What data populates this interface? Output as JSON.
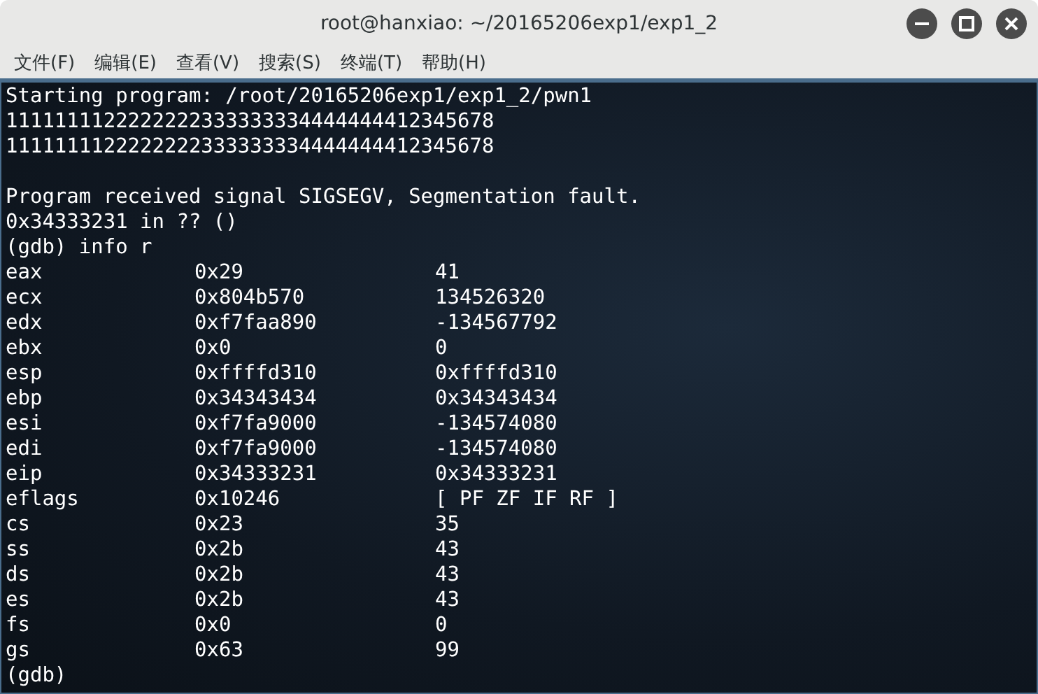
{
  "window": {
    "title": "root@hanxiao: ~/20165206exp1/exp1_2"
  },
  "menu": [
    "文件(F)",
    "编辑(E)",
    "查看(V)",
    "搜索(S)",
    "终端(T)",
    "帮助(H)"
  ],
  "terminal": {
    "blocks": [
      [
        "Starting program: /root/20165206exp1/exp1_2/pwn1",
        "1111111122222222333333334444444412345678",
        "1111111122222222333333334444444412345678"
      ],
      [
        "Program received signal SIGSEGV, Segmentation fault.",
        "0x34333231 in ?? ()",
        "(gdb) info r"
      ]
    ],
    "registers": [
      {
        "name": "eax",
        "hex": "0x29",
        "natural": "41"
      },
      {
        "name": "ecx",
        "hex": "0x804b570",
        "natural": "134526320"
      },
      {
        "name": "edx",
        "hex": "0xf7faa890",
        "natural": "-134567792"
      },
      {
        "name": "ebx",
        "hex": "0x0",
        "natural": "0"
      },
      {
        "name": "esp",
        "hex": "0xffffd310",
        "natural": "0xffffd310"
      },
      {
        "name": "ebp",
        "hex": "0x34343434",
        "natural": "0x34343434"
      },
      {
        "name": "esi",
        "hex": "0xf7fa9000",
        "natural": "-134574080"
      },
      {
        "name": "edi",
        "hex": "0xf7fa9000",
        "natural": "-134574080"
      },
      {
        "name": "eip",
        "hex": "0x34333231",
        "natural": "0x34333231"
      },
      {
        "name": "eflags",
        "hex": "0x10246",
        "natural": "[ PF ZF IF RF ]"
      },
      {
        "name": "cs",
        "hex": "0x23",
        "natural": "35"
      },
      {
        "name": "ss",
        "hex": "0x2b",
        "natural": "43"
      },
      {
        "name": "ds",
        "hex": "0x2b",
        "natural": "43"
      },
      {
        "name": "es",
        "hex": "0x2b",
        "natural": "43"
      },
      {
        "name": "fs",
        "hex": "0x0",
        "natural": "0"
      },
      {
        "name": "gs",
        "hex": "0x63",
        "natural": "99"
      }
    ],
    "prompt": "(gdb)"
  }
}
